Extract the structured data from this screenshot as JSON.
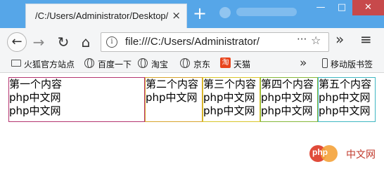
{
  "browser": {
    "tab_title": "/C:/Users/Administrator/Desktop/",
    "tab_close": "×",
    "new_tab": "+",
    "window_controls": {
      "minimize": "—",
      "maximize": "□",
      "close": "✕"
    }
  },
  "nav": {
    "back": "←",
    "forward": "→",
    "reload": "↻",
    "home": "⌂",
    "info": "i",
    "url": "file:///C:/Users/Administrator/",
    "url_more": "···",
    "star": "☆",
    "overflow": "»",
    "menu": "≡"
  },
  "bookmarks": {
    "items": [
      {
        "label": "火狐官方站点",
        "icon": "folder-icon"
      },
      {
        "label": "百度一下",
        "icon": "globe-icon"
      },
      {
        "label": "淘宝",
        "icon": "globe-icon"
      },
      {
        "label": "京东",
        "icon": "globe-icon"
      },
      {
        "label": "天猫",
        "icon": "tmall-icon",
        "icon_text": "淘"
      }
    ],
    "more": "»",
    "mobile": "移动版书签"
  },
  "content": {
    "boxes": [
      {
        "title": "第一个内容",
        "lines": [
          "php中文网",
          "php中文网"
        ]
      },
      {
        "title": "第二个内容",
        "lines": [
          "php中文网"
        ]
      },
      {
        "title": "第三个内容",
        "lines": [
          "php中文网",
          "php中文网"
        ]
      },
      {
        "title": "第四个内容",
        "lines": [
          "php中文网",
          "php中文网"
        ]
      },
      {
        "title": "第五个内容",
        "lines": [
          "php中文网",
          "php中文网"
        ]
      }
    ]
  },
  "watermark": {
    "logo_text": "php",
    "text": "中文网"
  },
  "colors": {
    "titlebar": "#56a6e8",
    "box1_border": "#b53570",
    "box2_border": "#d7a42c",
    "box3_border": "#d8c52a",
    "box4_border": "#86b83a",
    "box5_border": "#3fb7c2"
  }
}
